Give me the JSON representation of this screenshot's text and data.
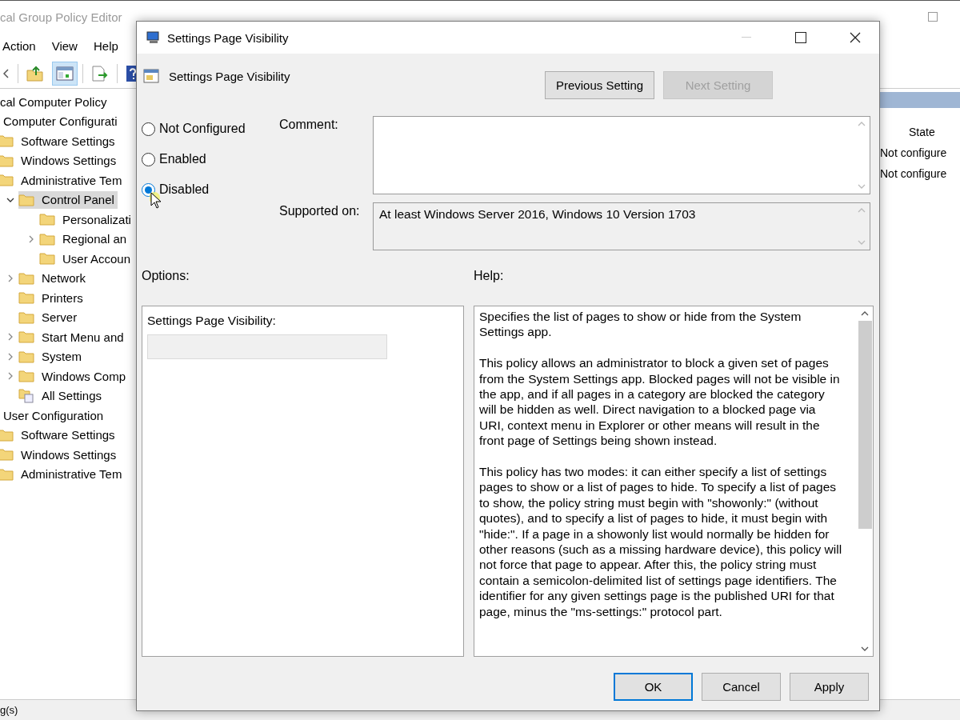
{
  "main_window": {
    "title": "cal Group Policy Editor",
    "menu": [
      "Action",
      "View",
      "Help"
    ],
    "toolbar": [
      {
        "kind": "back",
        "selected": false
      },
      {
        "kind": "up-folder",
        "selected": false
      },
      {
        "kind": "show-hide",
        "selected": true
      },
      {
        "kind": "export",
        "selected": false
      },
      {
        "kind": "help",
        "selected": false
      }
    ],
    "tree": [
      {
        "label": "cal Computer Policy",
        "kind": "root",
        "selected": false,
        "children": [
          {
            "label": "Computer Configurati",
            "kind": "plain",
            "selected": false,
            "children": [
              {
                "label": "Software Settings",
                "kind": "folder",
                "selected": false
              },
              {
                "label": "Windows Settings",
                "kind": "folder",
                "selected": false
              },
              {
                "label": "Administrative Tem",
                "kind": "folder",
                "selected": false,
                "children": [
                  {
                    "label": "Control Panel",
                    "kind": "folder",
                    "expanded": true,
                    "selected": true,
                    "children": [
                      {
                        "label": "Personalizati",
                        "kind": "folder",
                        "selected": false
                      },
                      {
                        "label": "Regional an",
                        "kind": "folder",
                        "expanded": false,
                        "selected": false
                      },
                      {
                        "label": "User Accoun",
                        "kind": "folder",
                        "selected": false
                      }
                    ]
                  },
                  {
                    "label": "Network",
                    "kind": "folder",
                    "expanded": false,
                    "selected": false
                  },
                  {
                    "label": "Printers",
                    "kind": "folder",
                    "selected": false
                  },
                  {
                    "label": "Server",
                    "kind": "folder",
                    "selected": false
                  },
                  {
                    "label": "Start Menu and",
                    "kind": "folder",
                    "expanded": false,
                    "selected": false
                  },
                  {
                    "label": "System",
                    "kind": "folder",
                    "expanded": false,
                    "selected": false
                  },
                  {
                    "label": "Windows Comp",
                    "kind": "folder",
                    "expanded": false,
                    "selected": false
                  },
                  {
                    "label": "All Settings",
                    "kind": "settings",
                    "selected": false
                  }
                ]
              }
            ]
          },
          {
            "label": "User Configuration",
            "kind": "plain",
            "selected": false,
            "children": [
              {
                "label": "Software Settings",
                "kind": "folder",
                "selected": false
              },
              {
                "label": "Windows Settings",
                "kind": "folder",
                "selected": false
              },
              {
                "label": "Administrative Tem",
                "kind": "folder",
                "selected": false
              }
            ]
          }
        ]
      }
    ],
    "list": {
      "columns": [
        "State"
      ],
      "rows": [
        {
          "state": "Not configure"
        },
        {
          "state": "Not configure"
        }
      ]
    },
    "status_bar": "g(s)"
  },
  "dialog": {
    "title": "Settings Page Visibility",
    "heading": "Settings Page Visibility",
    "nav_buttons": [
      {
        "label": "Previous Setting",
        "disabled": false
      },
      {
        "label": "Next Setting",
        "disabled": true
      }
    ],
    "options": [
      {
        "label": "Not Configured",
        "selected": false
      },
      {
        "label": "Enabled",
        "selected": false
      },
      {
        "label": "Disabled",
        "selected": true
      }
    ],
    "comment_label": "Comment:",
    "supported_label": "Supported on:",
    "supported_value": "At least Windows Server 2016, Windows 10 Version 1703",
    "options_label": "Options:",
    "help_label": "Help:",
    "option_field": {
      "label": "Settings Page Visibility:",
      "disabled": true
    },
    "help_text": [
      "Specifies the list of pages to show or hide from the System Settings app.",
      "This policy allows an administrator to block a given set of pages from the System Settings app. Blocked pages will not be visible in the app, and if all pages in a category are blocked the category will be hidden as well. Direct navigation to a blocked page via URI, context menu in Explorer or other means will result in the front page of Settings being shown instead.",
      "This policy has two modes: it can either specify a list of settings pages to show or a list of pages to hide. To specify a list of pages to show, the policy string must begin with \"showonly:\" (without quotes), and to specify a list of pages to hide, it must begin with \"hide:\". If a page in a showonly list would normally be hidden for other reasons (such as a missing hardware device), this policy will not force that page to appear. After this, the policy string must contain a semicolon-delimited list of settings page identifiers. The identifier for any given settings page is the published URI for that page, minus the \"ms-settings:\" protocol part."
    ],
    "buttons": [
      {
        "label": "OK",
        "focused": true
      },
      {
        "label": "Cancel",
        "focused": false
      },
      {
        "label": "Apply",
        "focused": false
      }
    ]
  }
}
